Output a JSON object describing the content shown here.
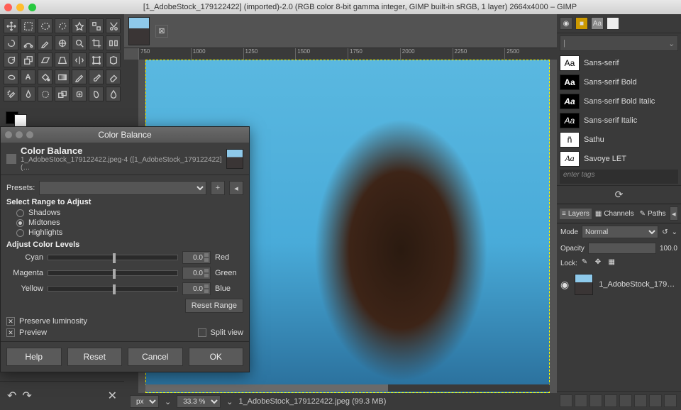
{
  "title": "[1_AdobeStock_179122422] (imported)-2.0 (RGB color 8-bit gamma integer, GIMP built-in sRGB, 1 layer) 2664x4000 – GIMP",
  "ruler_ticks": [
    "750",
    "1000",
    "1250",
    "1500",
    "1750",
    "2000",
    "2250",
    "2500"
  ],
  "status": {
    "unit": "px",
    "zoom": "33.3 %",
    "file": "1_AdobeStock_179122422.jpeg (99.3 MB)"
  },
  "dialog": {
    "title": "Color Balance",
    "heading": "Color Balance",
    "subheading": "1_AdobeStock_179122422.jpeg-4 ([1_AdobeStock_179122422] (…",
    "presets_label": "Presets:",
    "range_label": "Select Range to Adjust",
    "ranges": {
      "shadows": "Shadows",
      "midtones": "Midtones",
      "highlights": "Highlights"
    },
    "levels_label": "Adjust Color Levels",
    "sliders": [
      {
        "left": "Cyan",
        "value": "0.0",
        "right": "Red"
      },
      {
        "left": "Magenta",
        "value": "0.0",
        "right": "Green"
      },
      {
        "left": "Yellow",
        "value": "0.0",
        "right": "Blue"
      }
    ],
    "reset_range": "Reset Range",
    "preserve": "Preserve luminosity",
    "preview": "Preview",
    "split": "Split view",
    "buttons": {
      "help": "Help",
      "reset": "Reset",
      "cancel": "Cancel",
      "ok": "OK"
    }
  },
  "fonts": {
    "filter_placeholder": "",
    "list": [
      {
        "sample": "Aa",
        "name": "Sans-serif",
        "bold": false,
        "italic": false
      },
      {
        "sample": "Aa",
        "name": "Sans-serif Bold",
        "bold": true,
        "italic": false
      },
      {
        "sample": "Aa",
        "name": "Sans-serif Bold Italic",
        "bold": true,
        "italic": true
      },
      {
        "sample": "Aa",
        "name": "Sans-serif Italic",
        "bold": false,
        "italic": true
      },
      {
        "sample": "ñ",
        "name": "Sathu",
        "bold": false,
        "italic": false
      },
      {
        "sample": "Aa",
        "name": "Savoye LET",
        "bold": false,
        "italic": true
      }
    ],
    "tags_placeholder": "enter tags"
  },
  "layers": {
    "tabs": {
      "layers": "Layers",
      "channels": "Channels",
      "paths": "Paths"
    },
    "mode_label": "Mode",
    "mode_value": "Normal",
    "opacity_label": "Opacity",
    "opacity_value": "100.0",
    "lock_label": "Lock:",
    "item_name": "1_AdobeStock_179…"
  }
}
